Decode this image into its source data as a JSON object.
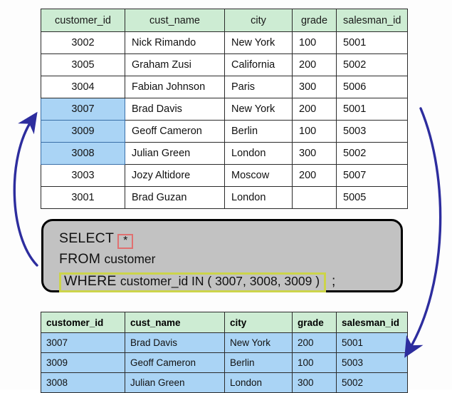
{
  "colors": {
    "header_green": "#cdecd3",
    "row_highlight_blue": "#aad4f5",
    "query_box_bg": "#c2c2c2",
    "arrow_blue": "#2d2d9e",
    "star_outline_red": "#e07070",
    "where_outline_yellow": "#ccd44a",
    "page_bg": "#fdfdfd"
  },
  "source_table": {
    "name": "customer",
    "columns": [
      "customer_id",
      "cust_name",
      "city",
      "grade",
      "salesman_id"
    ],
    "rows": [
      {
        "customer_id": "3002",
        "cust_name": "Nick Rimando",
        "city": "New York",
        "grade": "100",
        "salesman_id": "5001",
        "highlighted": false
      },
      {
        "customer_id": "3005",
        "cust_name": "Graham Zusi",
        "city": "California",
        "grade": "200",
        "salesman_id": "5002",
        "highlighted": false
      },
      {
        "customer_id": "3004",
        "cust_name": "Fabian Johnson",
        "city": "Paris",
        "grade": "300",
        "salesman_id": "5006",
        "highlighted": false
      },
      {
        "customer_id": "3007",
        "cust_name": "Brad Davis",
        "city": "New York",
        "grade": "200",
        "salesman_id": "5001",
        "highlighted": true
      },
      {
        "customer_id": "3009",
        "cust_name": "Geoff Cameron",
        "city": "Berlin",
        "grade": "100",
        "salesman_id": "5003",
        "highlighted": true
      },
      {
        "customer_id": "3008",
        "cust_name": "Julian Green",
        "city": "London",
        "grade": "300",
        "salesman_id": "5002",
        "highlighted": true
      },
      {
        "customer_id": "3003",
        "cust_name": "Jozy Altidore",
        "city": "Moscow",
        "grade": "200",
        "salesman_id": "5007",
        "highlighted": false
      },
      {
        "customer_id": "3001",
        "cust_name": "Brad Guzan",
        "city": "London",
        "grade": "",
        "salesman_id": "5005",
        "highlighted": false
      }
    ]
  },
  "query": {
    "line1_keyword": "SELECT",
    "line1_star": "*",
    "line2_keyword": "FROM",
    "line2_table": "customer",
    "line3_keyword": "WHERE",
    "line3_expression": "customer_id IN ( 3007, 3008, 3009 )",
    "line3_terminator": ";",
    "full_text": "SELECT * FROM customer WHERE customer_id IN ( 3007, 3008, 3009 ) ;"
  },
  "result_table": {
    "columns": [
      "customer_id",
      "cust_name",
      "city",
      "grade",
      "salesman_id"
    ],
    "rows": [
      {
        "customer_id": "3007",
        "cust_name": "Brad Davis",
        "city": "New York",
        "grade": "200",
        "salesman_id": "5001"
      },
      {
        "customer_id": "3009",
        "cust_name": "Geoff Cameron",
        "city": "Berlin",
        "grade": "100",
        "salesman_id": "5003"
      },
      {
        "customer_id": "3008",
        "cust_name": "Julian Green",
        "city": "London",
        "grade": "300",
        "salesman_id": "5002"
      }
    ]
  },
  "annotations": {
    "left_arrow_label": "query-to-source-rows-arrow",
    "right_arrow_label": "source-to-result-arrow"
  }
}
